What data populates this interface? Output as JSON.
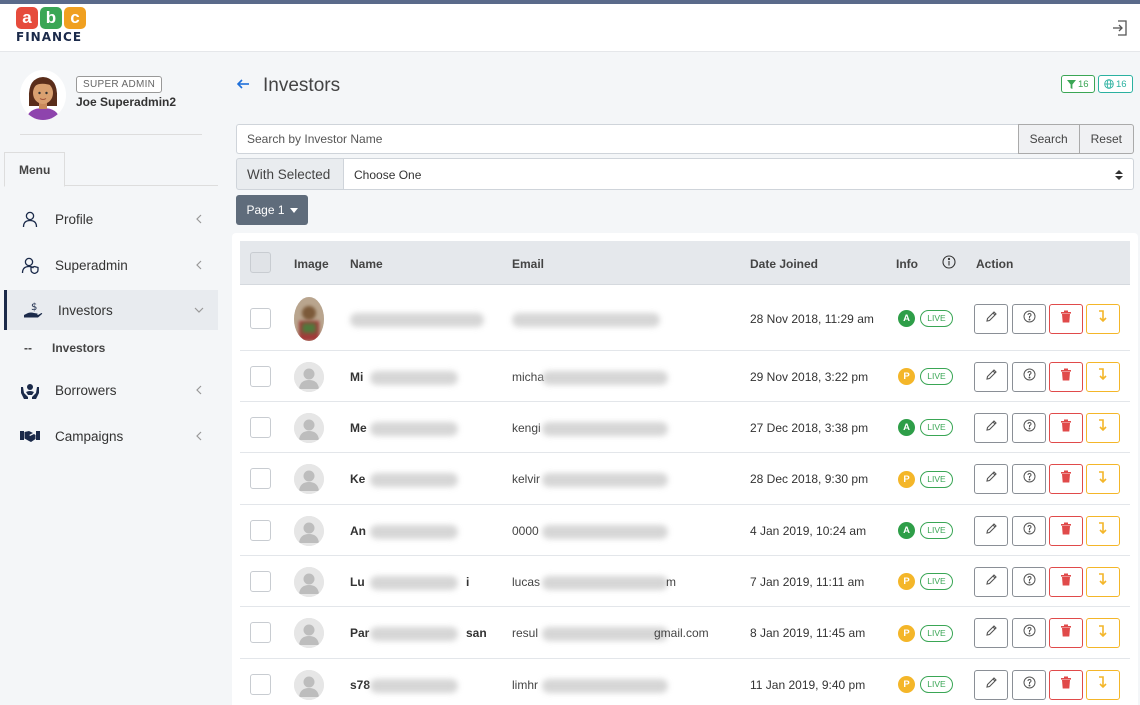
{
  "brand": {
    "letters": [
      "a",
      "b",
      "c"
    ],
    "word": "FINANCE",
    "colors": [
      "#e64b3c",
      "#3aa655",
      "#f0a020"
    ]
  },
  "topbar": {
    "logout_icon": "logout-icon"
  },
  "user": {
    "role": "SUPER ADMIN",
    "name": "Joe Superadmin2"
  },
  "sidebar": {
    "menu_tab": "Menu",
    "items": [
      {
        "label": "Profile",
        "icon": "user-icon"
      },
      {
        "label": "Superadmin",
        "icon": "user-shield-icon"
      },
      {
        "label": "Investors",
        "icon": "investor-hand-icon"
      },
      {
        "label": "Borrowers",
        "icon": "borrower-hands-icon"
      },
      {
        "label": "Campaigns",
        "icon": "handshake-icon"
      }
    ],
    "sub_item": {
      "dash": "--",
      "label": "Investors"
    }
  },
  "header": {
    "title": "Investors",
    "filter_count": "16",
    "globe_count": "16"
  },
  "search": {
    "placeholder": "Search by Investor Name",
    "value": "",
    "search_label": "Search",
    "reset_label": "Reset"
  },
  "with_selected": {
    "label": "With Selected",
    "selected": "Choose One"
  },
  "pagination": {
    "label": "Page 1"
  },
  "table": {
    "columns": {
      "image": "Image",
      "name": "Name",
      "email": "Email",
      "date_joined": "Date Joined",
      "info": "Info",
      "action": "Action"
    },
    "rows": [
      {
        "name": "",
        "email": "",
        "date": "28 Nov 2018, 11:29 am",
        "status": "A",
        "live": "LIVE"
      },
      {
        "name": "Mi",
        "email": "micha",
        "date": "29 Nov 2018, 3:22 pm",
        "status": "P",
        "live": "LIVE"
      },
      {
        "name": "Me",
        "email": "kengi",
        "date": "27 Dec 2018, 3:38 pm",
        "status": "A",
        "live": "LIVE"
      },
      {
        "name": "Ke",
        "email": "kelvir",
        "date": "28 Dec 2018, 9:30 pm",
        "status": "P",
        "live": "LIVE"
      },
      {
        "name": "An",
        "email": "0000",
        "date": "4 Jan 2019, 10:24 am",
        "status": "A",
        "live": "LIVE"
      },
      {
        "name": "Lu",
        "email": "lucas",
        "date": "7 Jan 2019, 11:11 am",
        "status": "P",
        "live": "LIVE"
      },
      {
        "name": "Par",
        "email": "resul",
        "date": "8 Jan 2019, 11:45 am",
        "status": "P",
        "live": "LIVE"
      },
      {
        "name": "s78",
        "email": "limhr",
        "date": "11 Jan 2019, 9:40 pm",
        "status": "P",
        "live": "LIVE"
      }
    ],
    "row_tails": [
      "",
      "",
      "",
      "",
      "",
      "i",
      "san",
      ""
    ],
    "email_tails": [
      "",
      "",
      "",
      "",
      "",
      "m",
      "gmail.com",
      ""
    ]
  },
  "colors": {
    "accent": "#1b2a4a",
    "green": "#2e9e48",
    "yellow": "#f4b629",
    "red": "#e04a4a",
    "teal": "#2bb1a0"
  }
}
